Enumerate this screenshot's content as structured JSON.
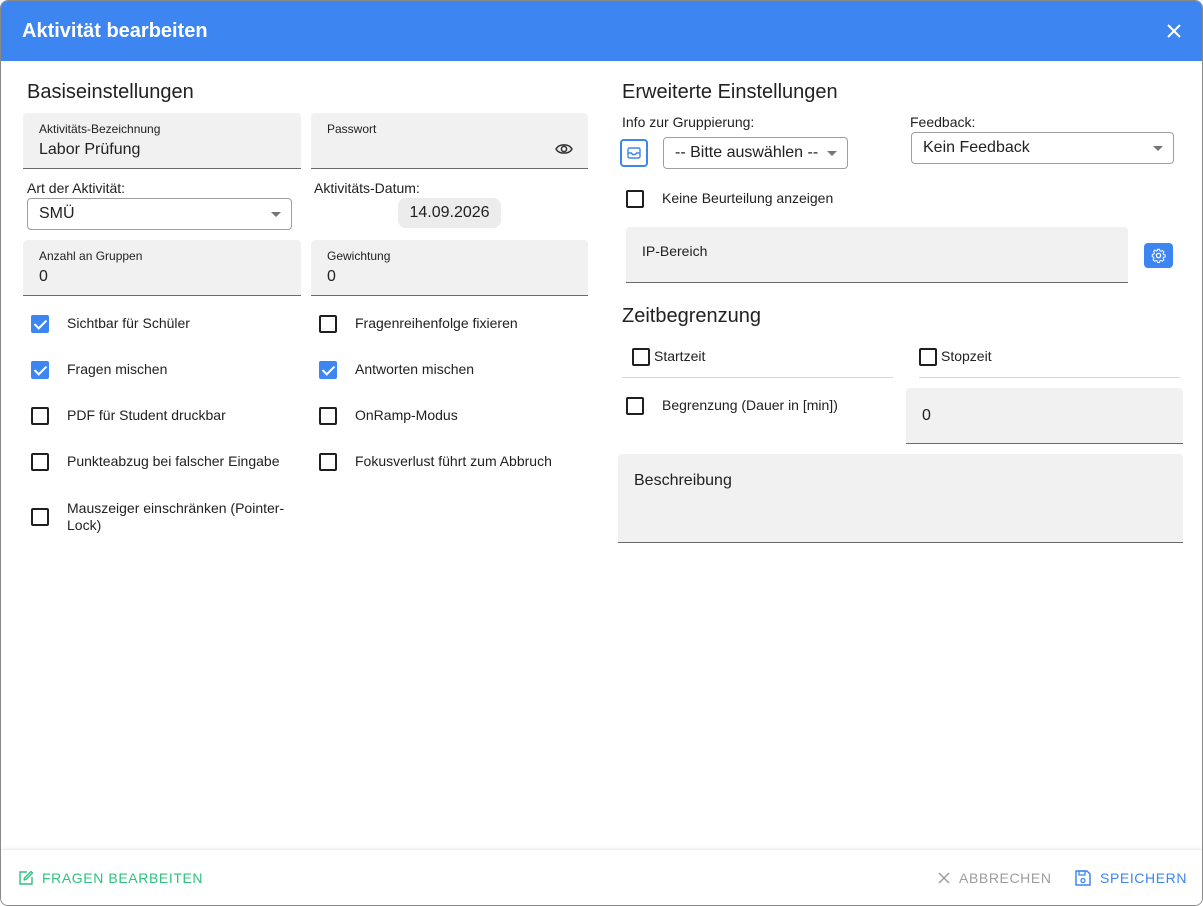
{
  "dialog": {
    "title": "Aktivität bearbeiten",
    "close_icon": "close-icon"
  },
  "basic": {
    "title": "Basiseinstellungen",
    "name_label": "Aktivitäts-Bezeichnung",
    "name_value": "Labor Prüfung",
    "password_label": "Passwort",
    "password_value": "",
    "type_label": "Art der Aktivität:",
    "type_value": "SMÜ",
    "date_label": "Aktivitäts-Datum:",
    "date_value": "14.09.2026",
    "groups_label": "Anzahl an Gruppen",
    "groups_value": "0",
    "weight_label": "Gewichtung",
    "weight_value": "0",
    "checkboxes_left": [
      {
        "label": "Sichtbar für Schüler",
        "checked": true
      },
      {
        "label": "Fragen mischen",
        "checked": true
      },
      {
        "label": "PDF für Student druckbar",
        "checked": false
      },
      {
        "label": "Punkteabzug bei falscher Eingabe",
        "checked": false
      },
      {
        "label": "Mauszeiger einschränken (Pointer-Lock)",
        "checked": false
      }
    ],
    "checkboxes_right": [
      {
        "label": "Fragenreihenfolge fixieren",
        "checked": false
      },
      {
        "label": "Antworten mischen",
        "checked": true
      },
      {
        "label": "OnRamp-Modus",
        "checked": false
      },
      {
        "label": "Fokusverlust führt zum Abbruch",
        "checked": false
      }
    ]
  },
  "advanced": {
    "title": "Erweiterte Einstellungen",
    "grouping_label": "Info zur Gruppierung:",
    "grouping_value": "-- Bitte auswählen --",
    "feedback_label": "Feedback:",
    "feedback_value": "Kein Feedback",
    "no_grade_label": "Keine Beurteilung anzeigen",
    "no_grade_checked": false,
    "ip_label": "IP-Bereich",
    "ip_value": ""
  },
  "time": {
    "title": "Zeitbegrenzung",
    "start_label": "Startzeit",
    "stop_label": "Stopzeit",
    "limit_label": "Begrenzung (Dauer in [min])",
    "limit_value": "0",
    "description_label": "Beschreibung"
  },
  "footer": {
    "edit_questions": "FRAGEN BEARBEITEN",
    "cancel": "ABBRECHEN",
    "save": "SPEICHERN"
  },
  "colors": {
    "primary": "#3d85f0",
    "success": "#2ec27e",
    "muted": "#9e9e9e"
  }
}
